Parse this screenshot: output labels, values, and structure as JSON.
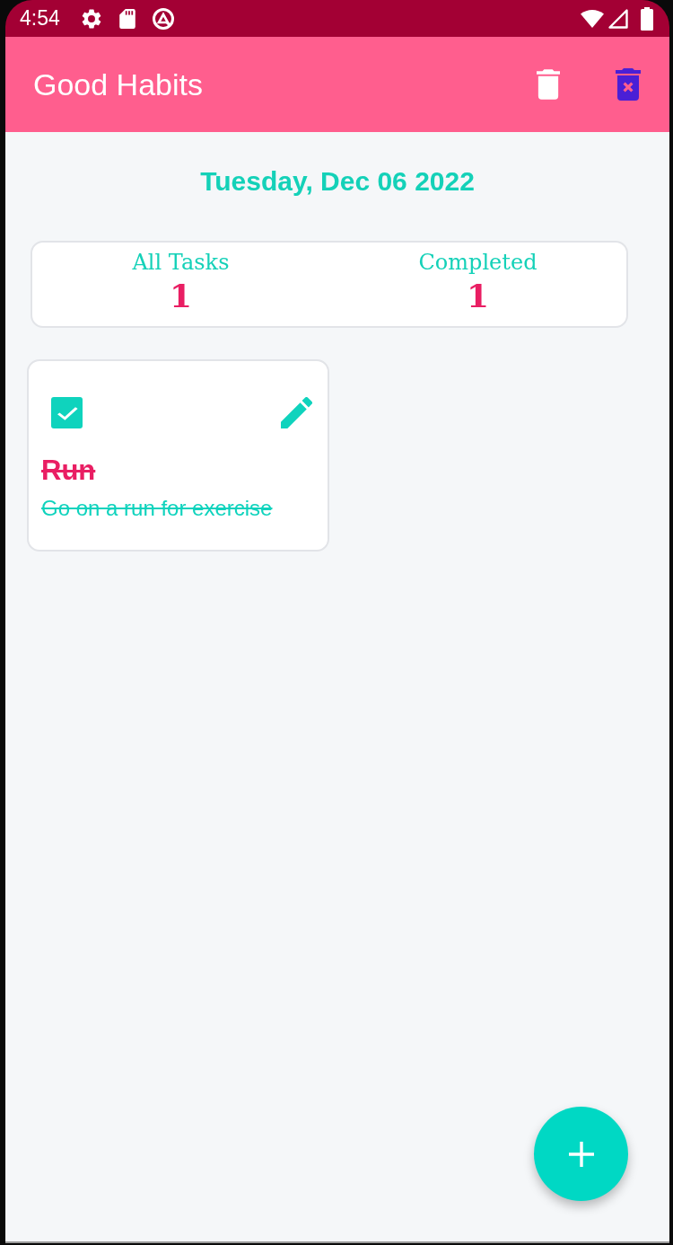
{
  "status_bar": {
    "time": "4:54"
  },
  "app_bar": {
    "title": "Good Habits"
  },
  "date": "Tuesday, Dec 06 2022",
  "stats": [
    {
      "label": "All Tasks",
      "value": "1"
    },
    {
      "label": "Completed",
      "value": "1"
    }
  ],
  "tasks": [
    {
      "title": "Run",
      "description": "Go on a run for exercise",
      "checked": true
    }
  ]
}
